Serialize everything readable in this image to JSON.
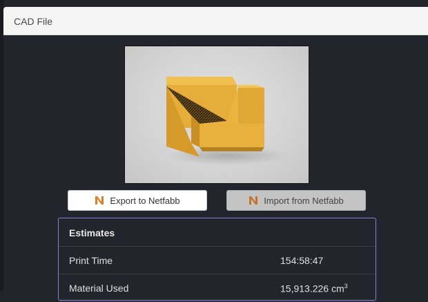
{
  "panel": {
    "title": "CAD File"
  },
  "preview": {
    "icon": "cad-model-preview"
  },
  "actions": {
    "export_label": "Export to Netfabb",
    "import_label": "Import from Netfabb",
    "netfabb_icon": "netfabb-n-icon",
    "netfabb_color": "#d9822b"
  },
  "estimates": {
    "title": "Estimates",
    "rows": [
      {
        "label": "Print Time",
        "value": "154:58:47",
        "unit": ""
      },
      {
        "label": "Material Used",
        "value": "15,913.226 cm",
        "unit": "3"
      }
    ]
  },
  "colors": {
    "background": "#23252c",
    "header_bg": "#f5f5f5",
    "estimates_border": "#8b82d6",
    "model_color": "#e5ac38"
  }
}
